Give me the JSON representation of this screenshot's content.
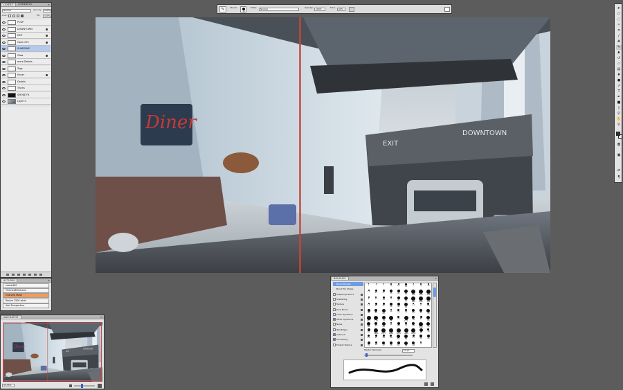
{
  "options_bar": {
    "brush_label": "Brush:",
    "brush_size": "19",
    "mode_label": "Mode:",
    "mode_value": "Normal",
    "opacity_label": "Opacity:",
    "opacity_value": "100%",
    "flow_label": "Flow:",
    "flow_value": "60%"
  },
  "layers_panel": {
    "tabs": [
      "LAYERS",
      "CHANNELS"
    ],
    "blend_mode": "Normal",
    "opacity_label": "Opacity:",
    "opacity_value": "100%",
    "lock_label": "Lock:",
    "fill_label": "Fill:",
    "fill_value": "100%",
    "layers": [
      {
        "name": "POSP",
        "thumb": "white",
        "locked": false,
        "selected": false
      },
      {
        "name": "DOWNTOWN",
        "thumb": "white",
        "locked": true,
        "selected": false
      },
      {
        "name": "EXIT",
        "thumb": "white",
        "locked": true,
        "selected": false
      },
      {
        "name": "Open 27h",
        "thumb": "white",
        "locked": true,
        "selected": false
      },
      {
        "name": "SHADOWS",
        "thumb": "white",
        "locked": false,
        "selected": true
      },
      {
        "name": "Glow",
        "thumb": "white",
        "locked": true,
        "selected": false
      },
      {
        "name": "more Details",
        "thumb": "white",
        "locked": false,
        "selected": false
      },
      {
        "name": "Tags",
        "thumb": "white",
        "locked": false,
        "selected": false
      },
      {
        "name": "Hover",
        "thumb": "white",
        "locked": true,
        "selected": false
      },
      {
        "name": "Details",
        "thumb": "white",
        "locked": false,
        "selected": false
      },
      {
        "name": "Trucks",
        "thumb": "white",
        "locked": false,
        "selected": false
      },
      {
        "name": "SMOKE FX",
        "thumb": "dark",
        "locked": false,
        "selected": false
      },
      {
        "name": "Layer 0",
        "thumb": "img",
        "locked": false,
        "selected": false
      }
    ]
  },
  "actions_panel": {
    "title": "ACTIONS",
    "items": [
      {
        "label": "resize400",
        "selected": false
      },
      {
        "label": "ThemedMiniIcons",
        "selected": false
      },
      {
        "label": "Unsharp Mask",
        "selected": true
      },
      {
        "label": "Resize 1500 wide",
        "selected": false
      },
      {
        "label": "Add Perspective",
        "selected": false
      }
    ]
  },
  "navigator_panel": {
    "title": "NAVIGATOR",
    "zoom": "33.33%"
  },
  "brushes_panel": {
    "title": "BRUSHES",
    "options": [
      {
        "label": "Brush Presets",
        "checkbox": false,
        "checked": false,
        "locked": false,
        "selected": true
      },
      {
        "label": "Brush Tip Shape",
        "checkbox": false,
        "checked": false,
        "locked": false,
        "selected": false
      },
      {
        "label": "Shape Dynamics",
        "checkbox": true,
        "checked": false,
        "locked": true,
        "selected": false
      },
      {
        "label": "Scattering",
        "checkbox": true,
        "checked": false,
        "locked": true,
        "selected": false
      },
      {
        "label": "Texture",
        "checkbox": true,
        "checked": false,
        "locked": true,
        "selected": false
      },
      {
        "label": "Dual Brush",
        "checkbox": true,
        "checked": false,
        "locked": true,
        "selected": false
      },
      {
        "label": "Color Dynamics",
        "checkbox": true,
        "checked": false,
        "locked": true,
        "selected": false
      },
      {
        "label": "Other Dynamics",
        "checkbox": true,
        "checked": true,
        "locked": true,
        "selected": false
      },
      {
        "label": "Noise",
        "checkbox": true,
        "checked": false,
        "locked": true,
        "selected": false
      },
      {
        "label": "Wet Edges",
        "checkbox": true,
        "checked": false,
        "locked": true,
        "selected": false
      },
      {
        "label": "Airbrush",
        "checkbox": true,
        "checked": true,
        "locked": true,
        "selected": false
      },
      {
        "label": "Smoothing",
        "checkbox": true,
        "checked": true,
        "locked": true,
        "selected": false
      },
      {
        "label": "Protect Texture",
        "checkbox": true,
        "checked": false,
        "locked": true,
        "selected": false
      }
    ],
    "master_diameter_label": "Master Diameter",
    "master_diameter_value": "19 px",
    "brush_sizes": [
      "1",
      "3",
      "5",
      "9",
      "13",
      "19",
      "5",
      "9",
      "13",
      "17",
      "21",
      "27",
      "35",
      "45",
      "65",
      "100",
      "200",
      "300",
      "9",
      "13",
      "19",
      "17",
      "45",
      "65",
      "100",
      "200",
      "300",
      "14",
      "24",
      "27",
      "39",
      "46",
      "59",
      "11",
      "17",
      "23",
      "36",
      "44",
      "60",
      "14",
      "26",
      "33",
      "42",
      "55",
      "70",
      "112",
      "134",
      "74",
      "95",
      "29",
      "192",
      "36",
      "33",
      "63",
      "66",
      "39",
      "63",
      "11",
      "48",
      "32",
      "55",
      "100",
      "75",
      "45",
      "1046",
      "1077",
      "1185",
      "1212",
      "1246",
      "1252",
      "75",
      "18",
      "22",
      "21",
      "24",
      "19",
      "64",
      "58",
      "21",
      "38",
      "45",
      "35",
      "19",
      "37",
      "38",
      "54",
      "79",
      "48",
      "14"
    ]
  },
  "colors": {
    "background": "#5c5c5c",
    "panel": "#e3e3e3",
    "selection_blue": "#b3c9ee",
    "action_highlight": "#f29b5c",
    "navigator_frame": "#e04040"
  }
}
